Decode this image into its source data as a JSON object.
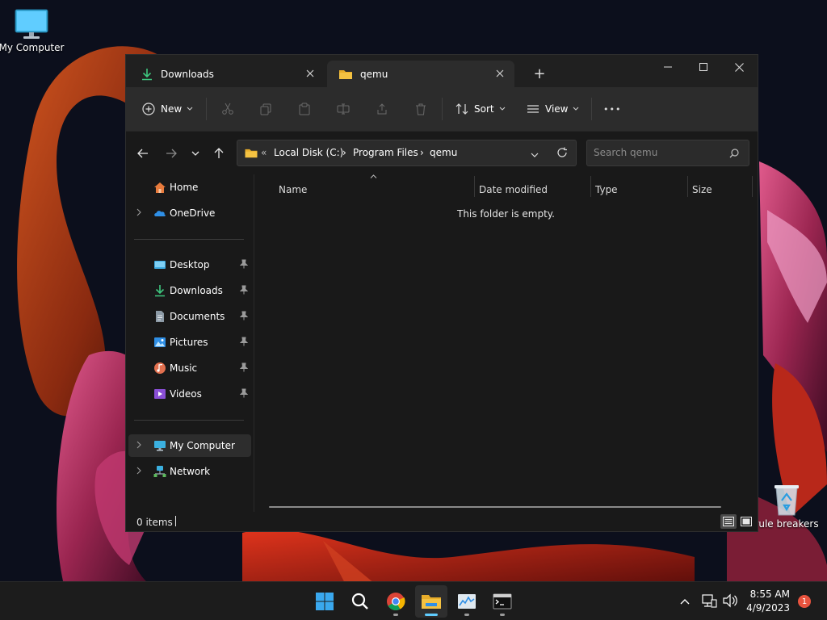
{
  "desktop": {
    "icons": [
      {
        "label": "My Computer",
        "icon": "monitor-icon"
      },
      {
        "label": "rule breakers",
        "icon": "recycle-bin-icon"
      }
    ]
  },
  "window": {
    "tabs": [
      {
        "label": "Downloads",
        "icon": "download-icon",
        "active": false
      },
      {
        "label": "qemu",
        "icon": "folder-icon",
        "active": true
      }
    ],
    "new_tab_glyph": "+",
    "toolbar": {
      "new_label": "New",
      "sort_label": "Sort",
      "view_label": "View",
      "more_glyph": "•••"
    },
    "address": {
      "overflow_glyph": "«",
      "crumbs": [
        "Local Disk (C:)",
        "Program Files",
        "qemu"
      ],
      "separator": "›"
    },
    "search": {
      "placeholder": "Search qemu"
    },
    "sidebar": {
      "items": [
        {
          "label": "Home",
          "icon": "home-icon"
        },
        {
          "label": "OneDrive",
          "icon": "onedrive-cloud-icon"
        },
        {
          "label": "Desktop",
          "icon": "desktop-folder-icon",
          "pinned": true
        },
        {
          "label": "Downloads",
          "icon": "download-icon",
          "pinned": true
        },
        {
          "label": "Documents",
          "icon": "document-icon",
          "pinned": true
        },
        {
          "label": "Pictures",
          "icon": "pictures-icon",
          "pinned": true
        },
        {
          "label": "Music",
          "icon": "music-icon",
          "pinned": true
        },
        {
          "label": "Videos",
          "icon": "videos-icon",
          "pinned": true
        },
        {
          "label": "My Computer",
          "icon": "monitor-icon",
          "selected": true
        },
        {
          "label": "Network",
          "icon": "network-icon"
        }
      ]
    },
    "columns": [
      "Name",
      "Date modified",
      "Type",
      "Size"
    ],
    "empty_message": "This folder is empty.",
    "status": {
      "count": "0 items"
    }
  },
  "taskbar": {
    "apps": [
      "windows-start-icon",
      "search-icon",
      "chrome-icon",
      "file-explorer-icon",
      "task-manager-icon",
      "terminal-icon"
    ],
    "clock": {
      "time": "8:55 AM",
      "date": "4/9/2023"
    },
    "notification_count": "1"
  },
  "colors": {
    "accent": "#60cdff",
    "folder": "#f4c242",
    "download": "#3ec77f",
    "notification": "#e8533e"
  }
}
